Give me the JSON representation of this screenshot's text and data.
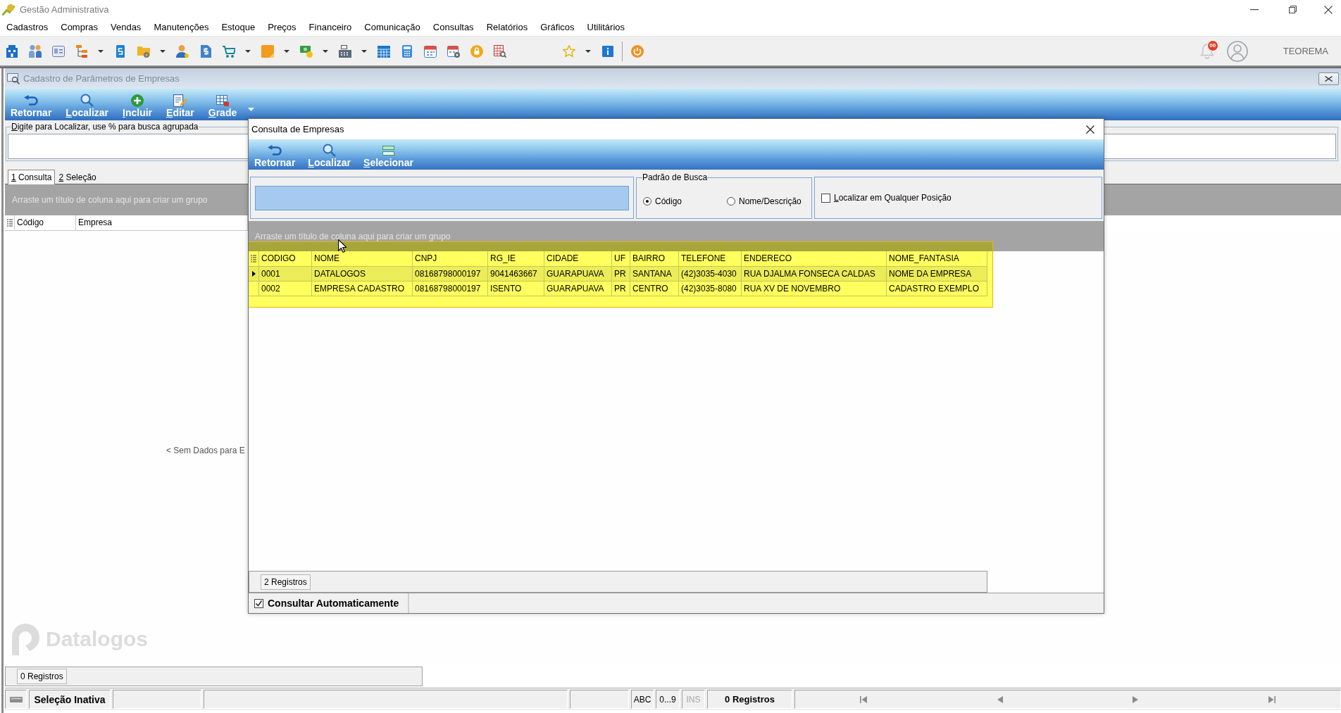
{
  "window": {
    "title": "Gestão Administrativa"
  },
  "menu": [
    "Cadastros",
    "Compras",
    "Vendas",
    "Manutenções",
    "Estoque",
    "Preços",
    "Financeiro",
    "Comunicação",
    "Consultas",
    "Relatórios",
    "Gráficos",
    "Utilitários"
  ],
  "notifications": {
    "badge": "00"
  },
  "user": {
    "name": "TEOREMA"
  },
  "form": {
    "title": "Cadastro de Parâmetros de Empresas",
    "toolbar": [
      {
        "kind": "return",
        "label": "Retornar",
        "mnemonic": false
      },
      {
        "kind": "search",
        "label": "Localizar",
        "mnemonic": true
      },
      {
        "kind": "add",
        "label": "Incluir",
        "mnemonic": true
      },
      {
        "kind": "edit",
        "label": "Editar",
        "mnemonic": true
      },
      {
        "kind": "grid",
        "label": "Grade",
        "mnemonic": true
      }
    ],
    "search": {
      "label": "Digite para Localizar, use % para busca agrupada",
      "mnemonic": true
    },
    "tabs": [
      {
        "label": "1 Consulta",
        "selected": true,
        "mnemonic": true
      },
      {
        "label": "2 Seleção",
        "selected": false,
        "mnemonic": true
      }
    ],
    "group_hint": "Arraste um título de coluna aqui para criar um grupo",
    "columns": [
      "Código",
      "Empresa"
    ],
    "empty_message": "< Sem Dados para E",
    "logo": "Datalogos",
    "record_count": "0 Registros"
  },
  "dialog": {
    "title": "Consulta de Empresas",
    "toolbar": [
      {
        "kind": "return",
        "label": "Retornar",
        "mnemonic": false
      },
      {
        "kind": "search",
        "label": "Localizar",
        "mnemonic": true
      },
      {
        "kind": "select",
        "label": "Selecionar",
        "mnemonic": true
      }
    ],
    "search_mode": {
      "title": "Padrão de Busca",
      "options": [
        {
          "label": "Código",
          "selected": true
        },
        {
          "label": "Nome/Descrição",
          "selected": false
        }
      ]
    },
    "any_position": {
      "label": "Localizar em Qualquer Posição",
      "checked": false,
      "mnemonic": true
    },
    "group_hint": "Arraste um título de coluna aqui para criar um grupo",
    "table": {
      "columns": [
        "CODIGO",
        "NOME",
        "CNPJ",
        "RG_IE",
        "CIDADE",
        "UF",
        "BAIRRO",
        "TELEFONE",
        "ENDERECO",
        "NOME_FANTASIA"
      ],
      "rows": [
        {
          "selected": true,
          "cells": [
            "0001",
            "DATALOGOS",
            "08168798000197",
            "9041463667",
            "GUARAPUAVA",
            "PR",
            "SANTANA",
            "(42)3035-4030",
            "RUA DJALMA FONSECA CALDAS",
            "NOME DA EMPRESA"
          ]
        },
        {
          "selected": false,
          "cells": [
            "0002",
            "EMPRESA CADASTRO",
            "08168798000197",
            "ISENTO",
            "GUARAPUAVA",
            "PR",
            "CENTRO",
            "(42)3035-8080",
            "RUA XV DE NOVEMBRO",
            "CADASTRO EXEMPLO"
          ]
        }
      ]
    },
    "record_count": "2 Registros",
    "auto_query": {
      "label": "Consultar Automaticamente",
      "checked": true
    }
  },
  "status_bar": {
    "selection": "Seleção Inativa",
    "indicators": [
      {
        "label": "ABC",
        "disabled": false
      },
      {
        "label": "0...9",
        "disabled": false
      },
      {
        "label": "INS",
        "disabled": true
      }
    ],
    "record_count": "0 Registros"
  }
}
